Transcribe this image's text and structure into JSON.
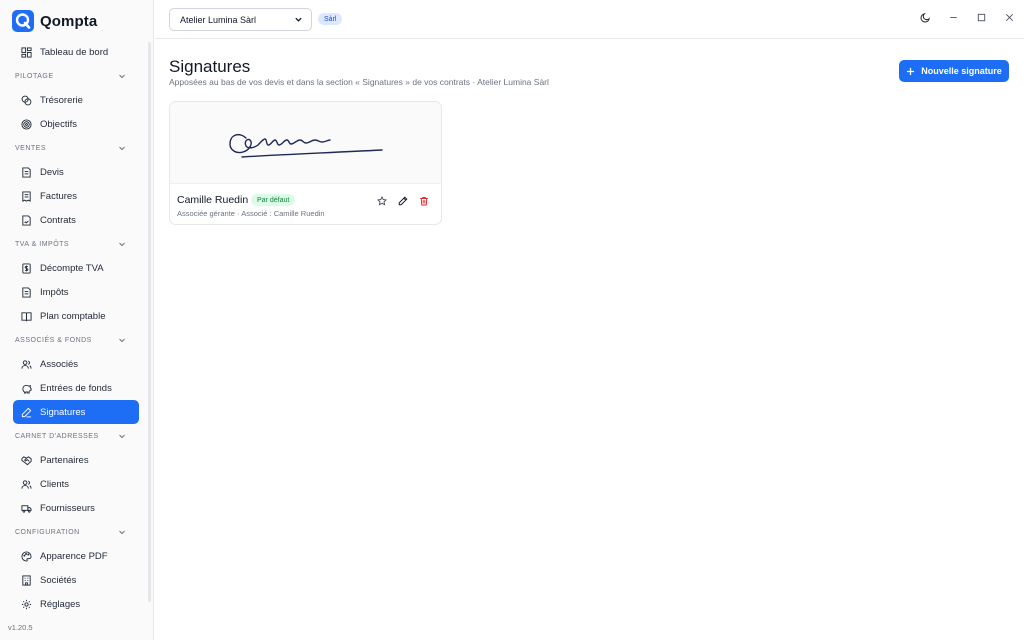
{
  "app": {
    "name": "Qompta",
    "version": "v1.20.5"
  },
  "colors": {
    "accent": "#1d6ef5",
    "success_bg": "#dcfce7",
    "success_fg": "#15803d",
    "danger": "#dc2626"
  },
  "topbar": {
    "company": "Atelier Lumina Sàrl",
    "company_type": "Sàrl",
    "icons": [
      "moon-icon",
      "minimize-icon",
      "maximize-icon",
      "close-icon"
    ]
  },
  "sidebar": {
    "top_item": {
      "label": "Tableau de bord",
      "icon": "dashboard-icon"
    },
    "sections": [
      {
        "title": "Pilotage",
        "items": [
          {
            "label": "Trésorerie",
            "icon": "coins-icon"
          },
          {
            "label": "Objectifs",
            "icon": "target-icon"
          }
        ]
      },
      {
        "title": "Ventes",
        "items": [
          {
            "label": "Devis",
            "icon": "quote-icon"
          },
          {
            "label": "Factures",
            "icon": "invoice-icon"
          },
          {
            "label": "Contrats",
            "icon": "contract-icon"
          }
        ]
      },
      {
        "title": "TVA & Impôts",
        "items": [
          {
            "label": "Décompte TVA",
            "icon": "vat-icon"
          },
          {
            "label": "Impôts",
            "icon": "tax-icon"
          },
          {
            "label": "Plan comptable",
            "icon": "book-icon"
          }
        ]
      },
      {
        "title": "Associés & Fonds",
        "items": [
          {
            "label": "Associés",
            "icon": "users-icon"
          },
          {
            "label": "Entrées de fonds",
            "icon": "piggy-bank-icon"
          },
          {
            "label": "Signatures",
            "icon": "pen-icon",
            "active": true
          }
        ]
      },
      {
        "title": "Carnet d'adresses",
        "items": [
          {
            "label": "Partenaires",
            "icon": "handshake-icon"
          },
          {
            "label": "Clients",
            "icon": "users-icon"
          },
          {
            "label": "Fournisseurs",
            "icon": "truck-icon"
          }
        ]
      },
      {
        "title": "Configuration",
        "items": [
          {
            "label": "Apparence PDF",
            "icon": "palette-icon"
          },
          {
            "label": "Sociétés",
            "icon": "building-icon"
          },
          {
            "label": "Réglages",
            "icon": "gear-icon"
          }
        ]
      }
    ]
  },
  "main": {
    "title": "Signatures",
    "subtitle": "Apposées au bas de vos devis et dans la section « Signatures » de vos contrats · Atelier Lumina Sàrl",
    "new_button": "Nouvelle signature",
    "signatures": [
      {
        "name": "Camille Ruedin",
        "badge": "Par défaut",
        "meta": "Associée gérante · Associé : Camille Ruedin"
      }
    ]
  }
}
